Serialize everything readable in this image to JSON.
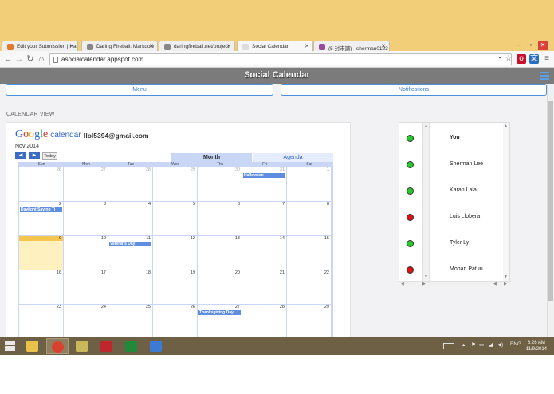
{
  "browser": {
    "tabs": [
      {
        "label": "Edit your Submission | Ha",
        "icon": "orange-favicon",
        "color": "#e37a2b",
        "active": false
      },
      {
        "label": "Daring Fireball: Markdow",
        "icon": "star-favicon",
        "color": "#888888",
        "active": false
      },
      {
        "label": "daringfireball.net/project",
        "icon": "star-favicon",
        "color": "#888888",
        "active": false
      },
      {
        "label": "Social Calendar",
        "icon": "blank-favicon",
        "color": "#dddddd",
        "active": true
      },
      {
        "label": "(5 封未讀) - sherman0123",
        "icon": "mail-favicon",
        "color": "#9b4b9b",
        "active": false
      }
    ],
    "url": "asocialcalendar.appspot.com"
  },
  "app": {
    "title": "Social Calendar",
    "menu_label": "Menu",
    "notifications_label": "Notifications",
    "calendar_view_label": "CALENDAR VIEW"
  },
  "calendar": {
    "logo_google": "Google",
    "logo_calendar": "calendar",
    "email": "llol5394@gmail.com",
    "month_label": "Nov 2014",
    "prev_label": "◀",
    "next_label": "▶",
    "today_label": "Today",
    "tab_month": "Month",
    "tab_agenda": "Agenda",
    "day_headers": [
      "Sun",
      "Mon",
      "Tue",
      "Wed",
      "Thu",
      "Fri",
      "Sat"
    ],
    "weeks": [
      [
        {
          "d": "26",
          "dim": true
        },
        {
          "d": "27",
          "dim": true
        },
        {
          "d": "28",
          "dim": true
        },
        {
          "d": "29",
          "dim": true
        },
        {
          "d": "30",
          "dim": true
        },
        {
          "d": "31",
          "dim": true,
          "event": "Halloween"
        },
        {
          "d": "1"
        }
      ],
      [
        {
          "d": "2",
          "event": "Daylight Saving Ti"
        },
        {
          "d": "3"
        },
        {
          "d": "4"
        },
        {
          "d": "5"
        },
        {
          "d": "6"
        },
        {
          "d": "7"
        },
        {
          "d": "8"
        }
      ],
      [
        {
          "d": "9",
          "today": true
        },
        {
          "d": "10"
        },
        {
          "d": "11",
          "event": "Veterans Day"
        },
        {
          "d": "12"
        },
        {
          "d": "13"
        },
        {
          "d": "14"
        },
        {
          "d": "15"
        }
      ],
      [
        {
          "d": "16"
        },
        {
          "d": "17"
        },
        {
          "d": "18"
        },
        {
          "d": "19"
        },
        {
          "d": "20"
        },
        {
          "d": "21"
        },
        {
          "d": "22"
        }
      ],
      [
        {
          "d": "23"
        },
        {
          "d": "24"
        },
        {
          "d": "25"
        },
        {
          "d": "26"
        },
        {
          "d": "27",
          "event": "Thanksgiving Day"
        },
        {
          "d": "28"
        },
        {
          "d": "29"
        }
      ]
    ]
  },
  "friends": [
    {
      "name": "You",
      "status": "online",
      "color": "#22cc22",
      "me": true
    },
    {
      "name": "Sherman Lee",
      "status": "online",
      "color": "#22cc22",
      "me": false
    },
    {
      "name": "Karan Lala",
      "status": "online",
      "color": "#22cc22",
      "me": false
    },
    {
      "name": "Luis Llobera",
      "status": "busy",
      "color": "#dd1111",
      "me": false
    },
    {
      "name": "Tyler Ly",
      "status": "online",
      "color": "#22cc22",
      "me": false
    },
    {
      "name": "Mohan Paturi",
      "status": "busy",
      "color": "#dd1111",
      "me": false
    }
  ],
  "taskbar": {
    "apps": [
      {
        "name": "file-explorer-icon",
        "color": "#e8c04a",
        "active": false
      },
      {
        "name": "chrome-icon",
        "color": "#d9412f",
        "active": true
      },
      {
        "name": "folder-app-icon",
        "color": "#c8b85a",
        "active": false
      },
      {
        "name": "red-app-icon",
        "color": "#c0272d",
        "active": false
      },
      {
        "name": "green-app-icon",
        "color": "#1e8a3a",
        "active": false
      },
      {
        "name": "blue-app-icon",
        "color": "#3b7bd6",
        "active": false
      }
    ],
    "language": "ENG",
    "time": "8:26 AM",
    "date": "11/9/2014"
  }
}
